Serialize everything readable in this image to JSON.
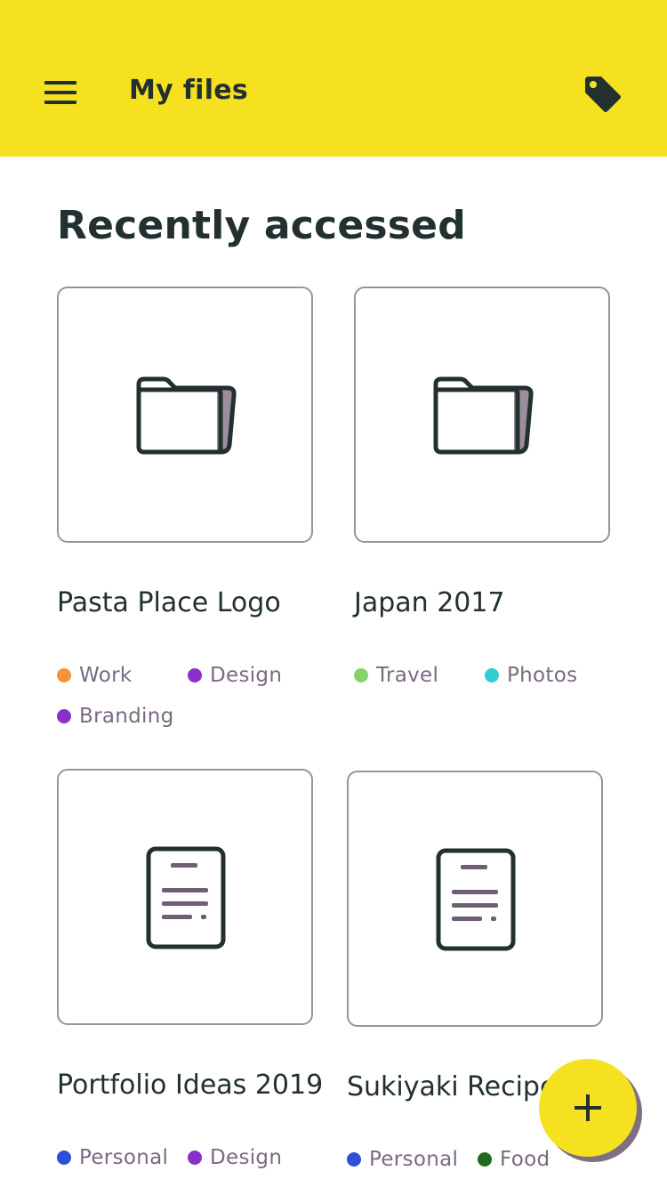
{
  "appbar": {
    "title": "My files",
    "menu_icon": "menu-icon",
    "tag_icon": "tag-icon",
    "color": "#f5e120"
  },
  "section": {
    "title": "Recently accessed"
  },
  "files": [
    {
      "name": "Pasta Place Logo",
      "type": "folder",
      "tags": [
        {
          "label": "Work",
          "color": "#f7923a"
        },
        {
          "label": "Design",
          "color": "#8a2fc9"
        },
        {
          "label": "Branding",
          "color": "#8a2fc9"
        }
      ]
    },
    {
      "name": "Japan 2017",
      "type": "folder",
      "tags": [
        {
          "label": "Travel",
          "color": "#88d16a"
        },
        {
          "label": "Photos",
          "color": "#2fcdd0"
        }
      ]
    },
    {
      "name": "Portfolio Ideas 2019",
      "type": "document",
      "tags": [
        {
          "label": "Personal",
          "color": "#2f4fd6"
        },
        {
          "label": "Design",
          "color": "#8a2fc9"
        }
      ]
    },
    {
      "name": "Sukiyaki Recipe",
      "type": "document",
      "tags": [
        {
          "label": "Personal",
          "color": "#2f4fd6"
        },
        {
          "label": "Food",
          "color": "#1f6a1f"
        }
      ]
    }
  ],
  "fab": {
    "icon": "plus-icon"
  }
}
